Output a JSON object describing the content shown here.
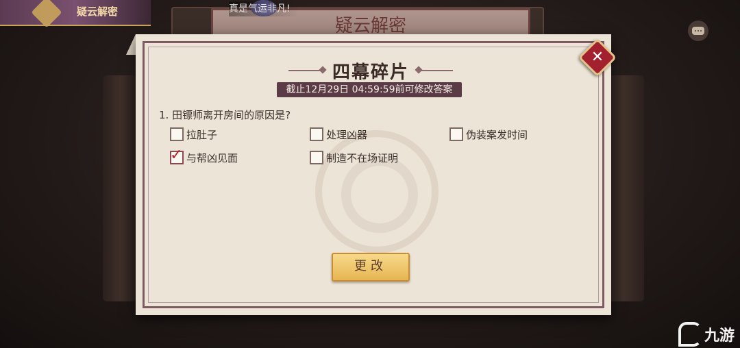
{
  "header": {
    "badge_title": "疑云解密",
    "chat_message": "真是气运非凡!"
  },
  "background": {
    "sign_title": "疑云解密"
  },
  "dialog": {
    "title": "四幕碎片",
    "deadline": "截止12月29日 04:59:59前可修改答案",
    "question": "1. 田镖师离开房间的原因是?",
    "options": [
      {
        "label": "拉肚子",
        "checked": false
      },
      {
        "label": "处理凶器",
        "checked": false
      },
      {
        "label": "伪装案发时间",
        "checked": false
      },
      {
        "label": "与帮凶见面",
        "checked": true
      },
      {
        "label": "制造不在场证明",
        "checked": false
      }
    ],
    "checkmark": "✓",
    "edit_button": "更改",
    "close_symbol": "✕"
  },
  "watermark": {
    "brand": "九游"
  },
  "icons": [
    "close-icon",
    "chat-icon",
    "checkmark-icon",
    "emblem-icon"
  ]
}
